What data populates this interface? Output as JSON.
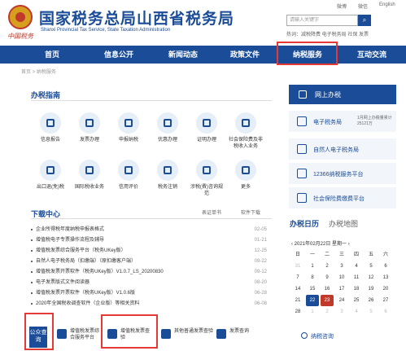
{
  "header": {
    "title": "国家税务总局山西省税务局",
    "subtitle": "Shanxi Provincial Tax Service, State Taxation Administration",
    "mark": "中国税务",
    "search_placeholder": "请输入关键字",
    "search_icon": "search-icon",
    "social": [
      "微博",
      "微信",
      "English"
    ],
    "hot": "热词：减税降费  电子税务局  社保  发票"
  },
  "nav": [
    "首页",
    "信息公开",
    "新闻动态",
    "政策文件",
    "纳税服务",
    "互动交流"
  ],
  "breadcrumb": "首页 > 纳税服务",
  "guide": {
    "title": "办税指南",
    "items": [
      "信息报告",
      "发票办理",
      "申报纳税",
      "优惠办理",
      "证明办理",
      "社会保险费及非税收入业务",
      "出口退(免)税",
      "国际税收业务",
      "信用评价",
      "税务注销",
      "涉税(費)咨询规范",
      "更多"
    ]
  },
  "downloads": {
    "title": "下载中心",
    "tabs": [
      "表证单书",
      "软件下载"
    ],
    "items": [
      {
        "t": "企业所得税年度纳税申报表格式",
        "d": "02-05"
      },
      {
        "t": "增值税电子专票操作流程及辅导",
        "d": "01-21"
      },
      {
        "t": "增值税发票综合服务平台（税务UKey版）",
        "d": "12-25"
      },
      {
        "t": "自然人电子税务局（扣缴端）（原扣缴客户端）",
        "d": "09-22"
      },
      {
        "t": "增值税发票开票软件（税务UKey版）V1.0.7_LS_20200830",
        "d": "09-12"
      },
      {
        "t": "电子发票版式文件阅读器",
        "d": "08-20"
      },
      {
        "t": "增值税发票开票软件（税务UKey版）V1.0.6版",
        "d": "06-28"
      },
      {
        "t": "2020年全国税收调查软件（企业版）等相关资料",
        "d": "06-08"
      }
    ]
  },
  "public_query": "公众查询",
  "bottom": [
    "增值税发票综合服务平台",
    "增值税发票查验",
    "其他普通发票查验",
    "发票查询"
  ],
  "right": {
    "online": "网上办税",
    "cards": [
      {
        "label": "电子税务局",
        "note": "1月网上办税量累计25121万"
      },
      {
        "label": "自然人电子税务局",
        "note": ""
      },
      {
        "label": "12366纳税服务平台",
        "note": ""
      },
      {
        "label": "社会保险费缴费平台",
        "note": ""
      }
    ],
    "tabs": [
      "办税日历",
      "办税地图"
    ],
    "cal_header": "‹  2021年02月22日   星期一  ›",
    "weekdays": [
      "日",
      "一",
      "二",
      "三",
      "四",
      "五",
      "六"
    ],
    "days": [
      [
        "31",
        "1",
        "2",
        "3",
        "4",
        "5",
        "6"
      ],
      [
        "7",
        "8",
        "9",
        "10",
        "11",
        "12",
        "13"
      ],
      [
        "14",
        "15",
        "16",
        "17",
        "18",
        "19",
        "20"
      ],
      [
        "21",
        "22",
        "23",
        "24",
        "25",
        "26",
        "27"
      ],
      [
        "28",
        "1",
        "2",
        "3",
        "4",
        "5",
        "6"
      ]
    ],
    "consult": "纳税咨询"
  },
  "colors": {
    "brand": "#1a4c97",
    "highlight": "#e53935",
    "red": "#c0392b"
  }
}
